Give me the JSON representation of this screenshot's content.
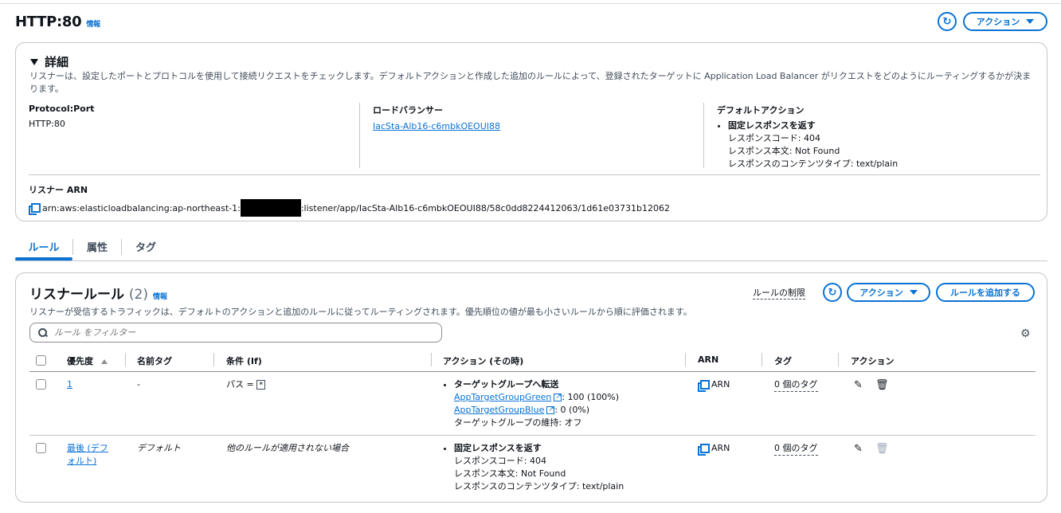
{
  "header": {
    "title": "HTTP:80",
    "info": "情報",
    "action_label": "アクション"
  },
  "details": {
    "heading": "詳細",
    "description": "リスナーは、設定したポートとプロトコルを使用して接続リクエストをチェックします。デフォルトアクションと作成した追加のルールによって、登録されたターゲットに Application Load Balancer がリクエストをどのようにルーティングするかが決まります。",
    "protocol_label": "Protocol:Port",
    "protocol_value": "HTTP:80",
    "lb_label": "ロードバランサー",
    "lb_value": "IacSta-Alb16-c6mbkOEOUI88",
    "default_action_label": "デフォルトアクション",
    "default_action": {
      "title": "固定レスポンスを返す",
      "code": "レスポンスコード: 404",
      "body": "レスポンス本文: Not Found",
      "content_type": "レスポンスのコンテンツタイプ: text/plain"
    },
    "arn_label": "リスナー ARN",
    "arn_prefix": "arn:aws:elasticloadbalancing:ap-northeast-1:",
    "arn_suffix": ":listener/app/IacSta-Alb16-c6mbkOEOUI88/58c0dd8224412063/1d61e03731b12062"
  },
  "tabs": [
    {
      "label": "ルール",
      "active": true
    },
    {
      "label": "属性",
      "active": false
    },
    {
      "label": "タグ",
      "active": false
    }
  ],
  "rules": {
    "title": "リスナールール",
    "count": "(2)",
    "info": "情報",
    "limit_link": "ルールの制限",
    "action_label": "アクション",
    "add_label": "ルールを追加する",
    "description": "リスナーが受信するトラフィックは、デフォルトのアクションと追加のルールに従ってルーティングされます。優先順位の値が最も小さいルールから順に評価されます。",
    "filter_placeholder": "ルール をフィルター",
    "columns": [
      "優先度",
      "名前タグ",
      "条件 (If)",
      "アクション (その時)",
      "ARN",
      "タグ",
      "アクション"
    ],
    "rows": [
      {
        "priority": "1",
        "name": "-",
        "condition_prefix": "パス = ",
        "condition_value": "*",
        "action_title": "ターゲットグループへ転送",
        "tg1_name": "AppTargetGroupGreen",
        "tg1_weight": ": 100 (100%)",
        "tg2_name": "AppTargetGroupBlue",
        "tg2_weight": ": 0 (0%)",
        "stickiness": "ターゲットグループの維持: オフ",
        "arn": "ARN",
        "tags": "0 個のタグ"
      },
      {
        "priority": "最後 (デフォルト)",
        "name": "デフォルト",
        "condition": "他のルールが適用されない場合",
        "action_title": "固定レスポンスを返す",
        "code": "レスポンスコード: 404",
        "body": "レスポンス本文: Not Found",
        "content_type": "レスポンスのコンテンツタイプ: text/plain",
        "arn": "ARN",
        "tags": "0 個のタグ"
      }
    ]
  },
  "colors": {
    "accent": "#0972d3",
    "border": "#c6c6cd",
    "text": "#0f141a"
  }
}
